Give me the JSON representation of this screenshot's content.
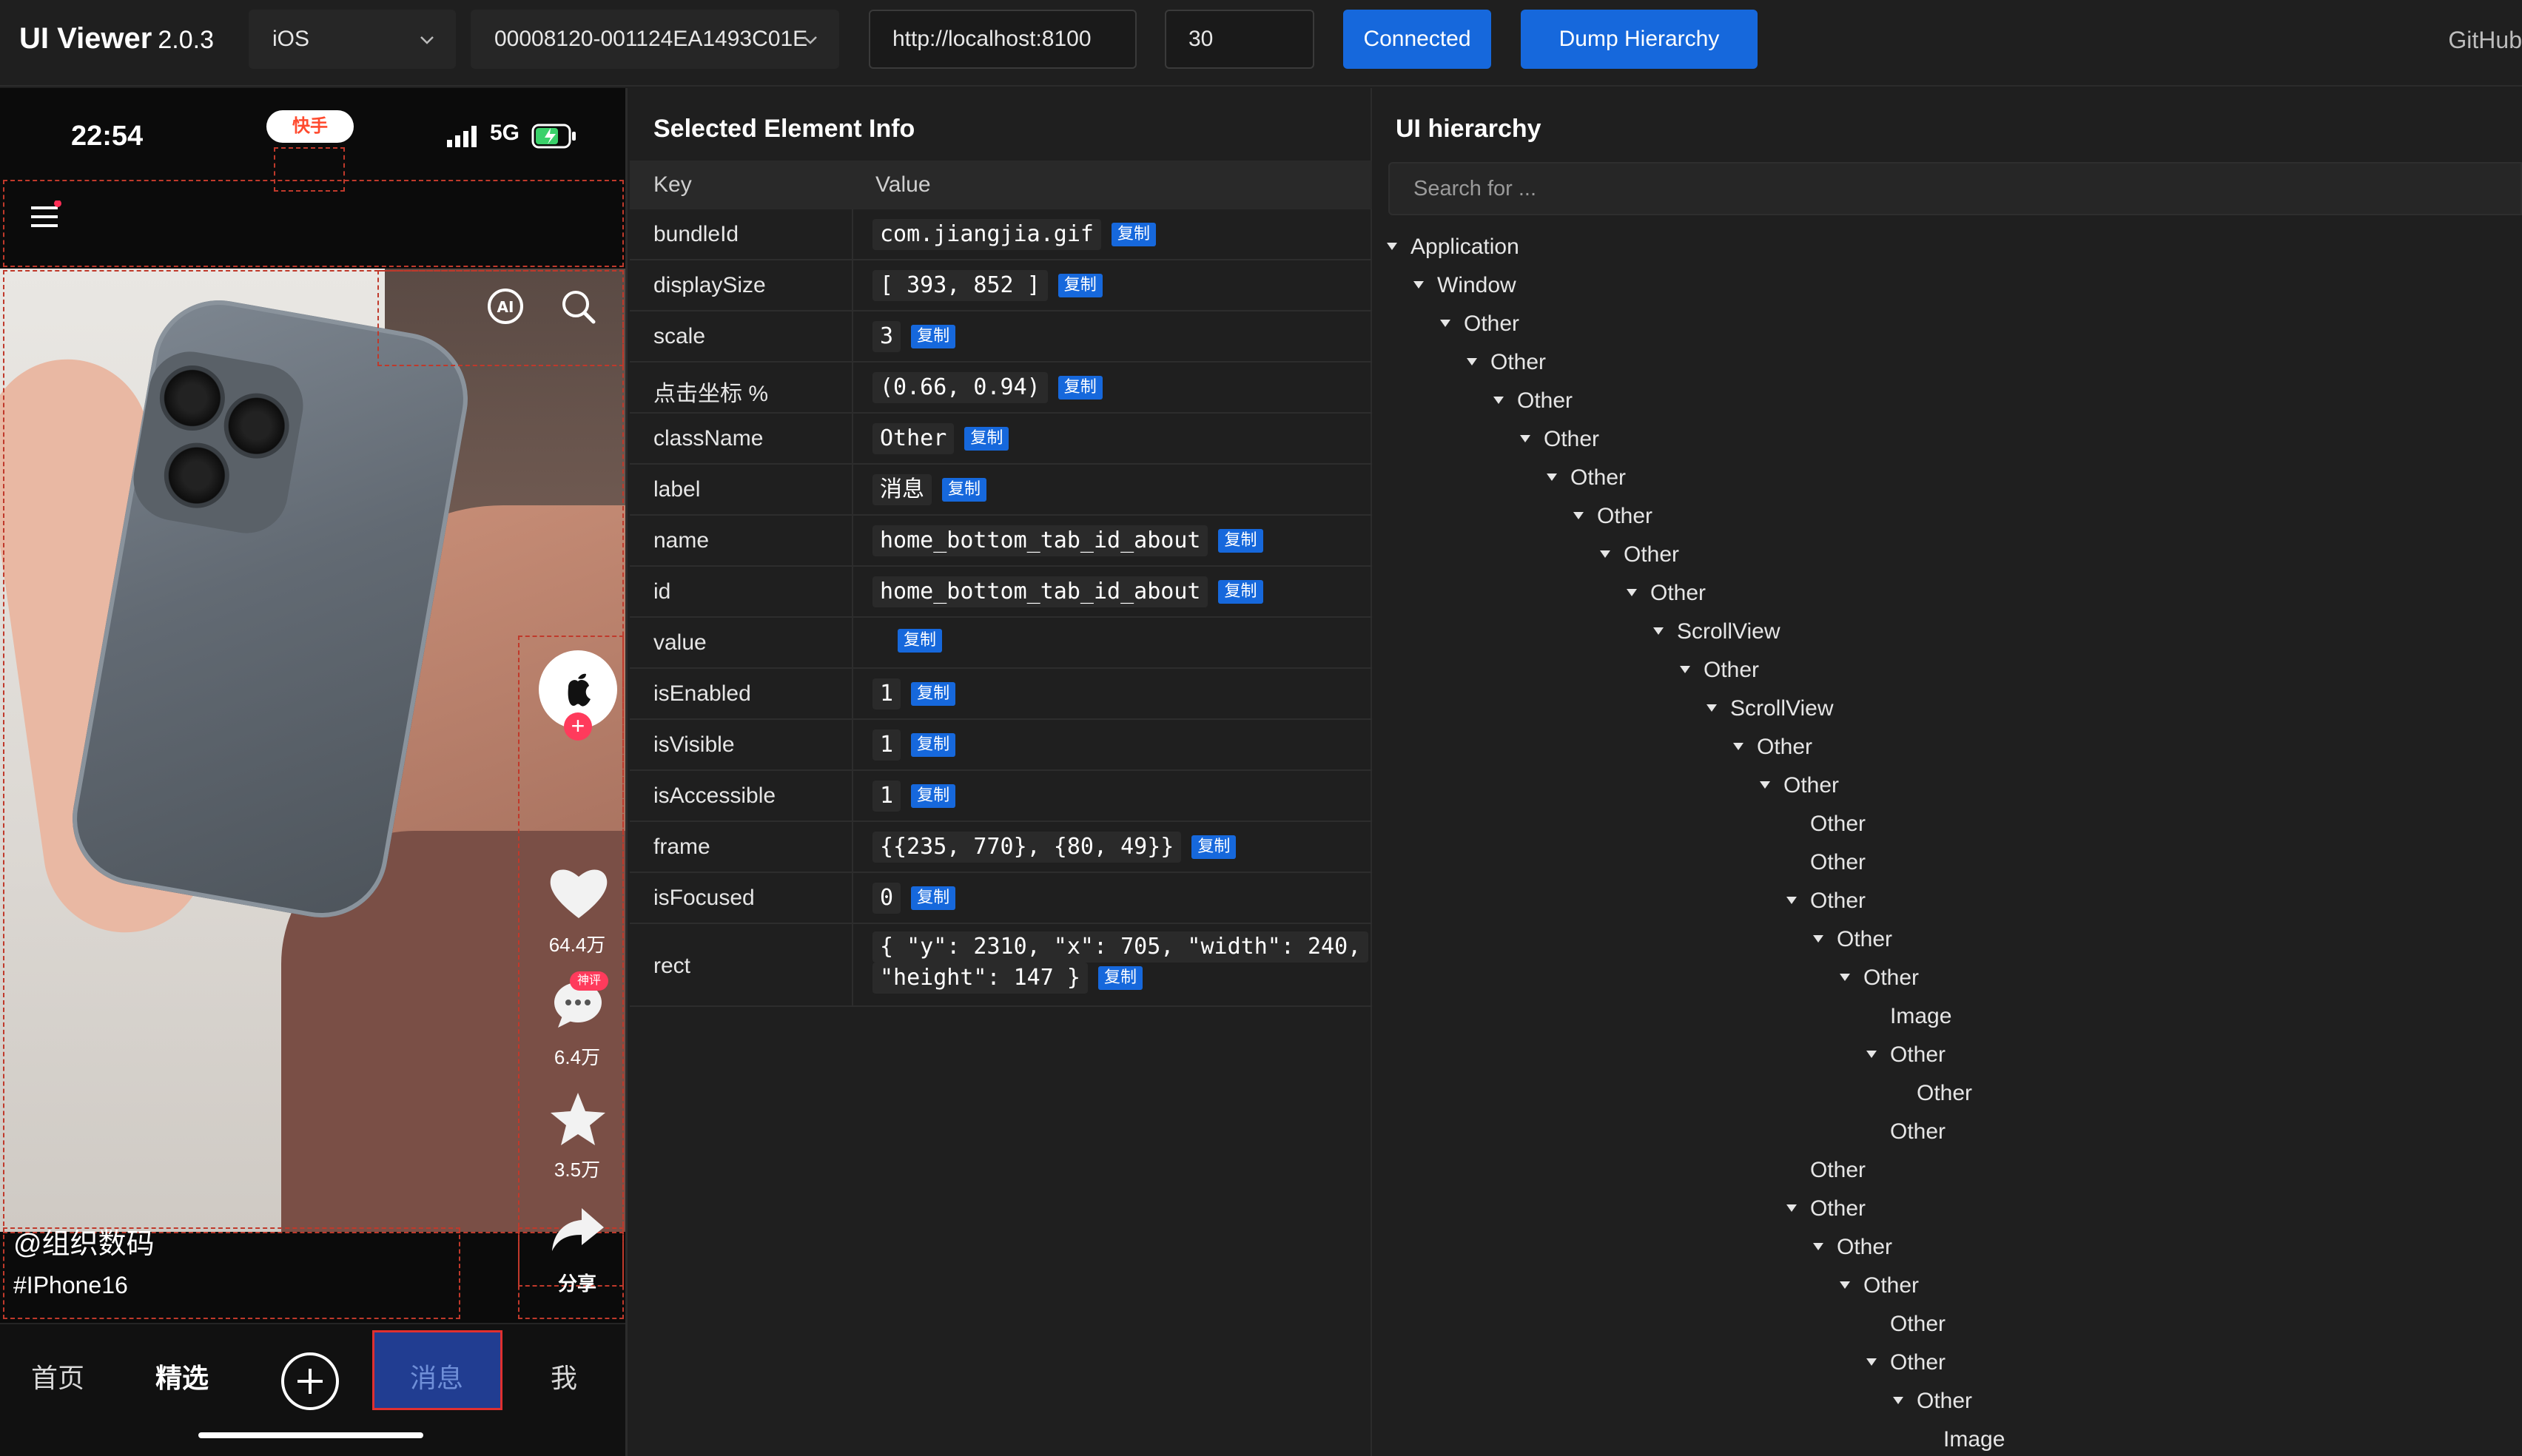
{
  "app": {
    "title": "UI Viewer",
    "version": "2.0.3",
    "github": "GitHub"
  },
  "toolbar": {
    "platform": "iOS",
    "device": "00008120-001124EA1493C01E",
    "url": "http://localhost:8100",
    "timeout": "30",
    "connected_label": "Connected",
    "dump_label": "Dump Hierarchy"
  },
  "phone": {
    "time": "22:54",
    "app_badge": "快手",
    "network": "5G",
    "rail": {
      "likes": "64.4万",
      "comments": "6.4万",
      "comment_badge": "神评",
      "favorites": "3.5万",
      "share": "分享"
    },
    "caption_user": "@组织数码",
    "caption_tag": "#IPhone16",
    "tabs": [
      "首页",
      "精选",
      "消息",
      "我"
    ]
  },
  "info": {
    "title": "Selected Element Info",
    "col_key": "Key",
    "col_value": "Value",
    "copy_label": "复制",
    "rows": [
      {
        "key": "bundleId",
        "value": "com.jiangjia.gif"
      },
      {
        "key": "displaySize",
        "value": "[ 393, 852 ]"
      },
      {
        "key": "scale",
        "value": "3"
      },
      {
        "key": "点击坐标 %",
        "value": "(0.66, 0.94)"
      },
      {
        "key": "className",
        "value": "Other"
      },
      {
        "key": "label",
        "value": "消息"
      },
      {
        "key": "name",
        "value": "home_bottom_tab_id_about"
      },
      {
        "key": "id",
        "value": "home_bottom_tab_id_about"
      },
      {
        "key": "value",
        "value": ""
      },
      {
        "key": "isEnabled",
        "value": "1"
      },
      {
        "key": "isVisible",
        "value": "1"
      },
      {
        "key": "isAccessible",
        "value": "1"
      },
      {
        "key": "frame",
        "value": "{{235, 770}, {80, 49}}"
      },
      {
        "key": "isFocused",
        "value": "0"
      },
      {
        "key": "rect",
        "value": "{ \"y\": 2310, \"x\": 705, \"width\": 240,",
        "value2": "\"height\": 147 }"
      }
    ]
  },
  "hierarchy": {
    "title": "UI hierarchy",
    "search_placeholder": "Search for ...",
    "nodes": [
      {
        "label": "Application",
        "depth": 0,
        "expanded": true
      },
      {
        "label": "Window",
        "depth": 1,
        "expanded": true
      },
      {
        "label": "Other",
        "depth": 2,
        "expanded": true
      },
      {
        "label": "Other",
        "depth": 3,
        "expanded": true
      },
      {
        "label": "Other",
        "depth": 4,
        "expanded": true
      },
      {
        "label": "Other",
        "depth": 5,
        "expanded": true
      },
      {
        "label": "Other",
        "depth": 6,
        "expanded": true
      },
      {
        "label": "Other",
        "depth": 7,
        "expanded": true
      },
      {
        "label": "Other",
        "depth": 8,
        "expanded": true
      },
      {
        "label": "Other",
        "depth": 9,
        "expanded": true
      },
      {
        "label": "ScrollView",
        "depth": 10,
        "expanded": true
      },
      {
        "label": "Other",
        "depth": 11,
        "expanded": true
      },
      {
        "label": "ScrollView",
        "depth": 12,
        "expanded": true
      },
      {
        "label": "Other",
        "depth": 13,
        "expanded": true
      },
      {
        "label": "Other",
        "depth": 14,
        "expanded": true
      },
      {
        "label": "Other",
        "depth": 15,
        "expanded": false
      },
      {
        "label": "Other",
        "depth": 15,
        "expanded": false
      },
      {
        "label": "Other",
        "depth": 15,
        "expanded": true
      },
      {
        "label": "Other",
        "depth": 16,
        "expanded": true
      },
      {
        "label": "Other",
        "depth": 17,
        "expanded": true
      },
      {
        "label": "Image",
        "depth": 18,
        "expanded": false
      },
      {
        "label": "Other",
        "depth": 18,
        "expanded": true
      },
      {
        "label": "Other",
        "depth": 19,
        "expanded": false
      },
      {
        "label": "Other",
        "depth": 18,
        "expanded": false
      },
      {
        "label": "Other",
        "depth": 15,
        "expanded": false
      },
      {
        "label": "Other",
        "depth": 15,
        "expanded": true
      },
      {
        "label": "Other",
        "depth": 16,
        "expanded": true
      },
      {
        "label": "Other",
        "depth": 17,
        "expanded": true
      },
      {
        "label": "Other",
        "depth": 18,
        "expanded": false
      },
      {
        "label": "Other",
        "depth": 18,
        "expanded": true
      },
      {
        "label": "Other",
        "depth": 19,
        "expanded": true
      },
      {
        "label": "Image",
        "depth": 20,
        "expanded": false
      }
    ]
  },
  "colors": {
    "accent": "#1668dc",
    "background": "#1f1f1f",
    "selection": "#c0392b"
  }
}
